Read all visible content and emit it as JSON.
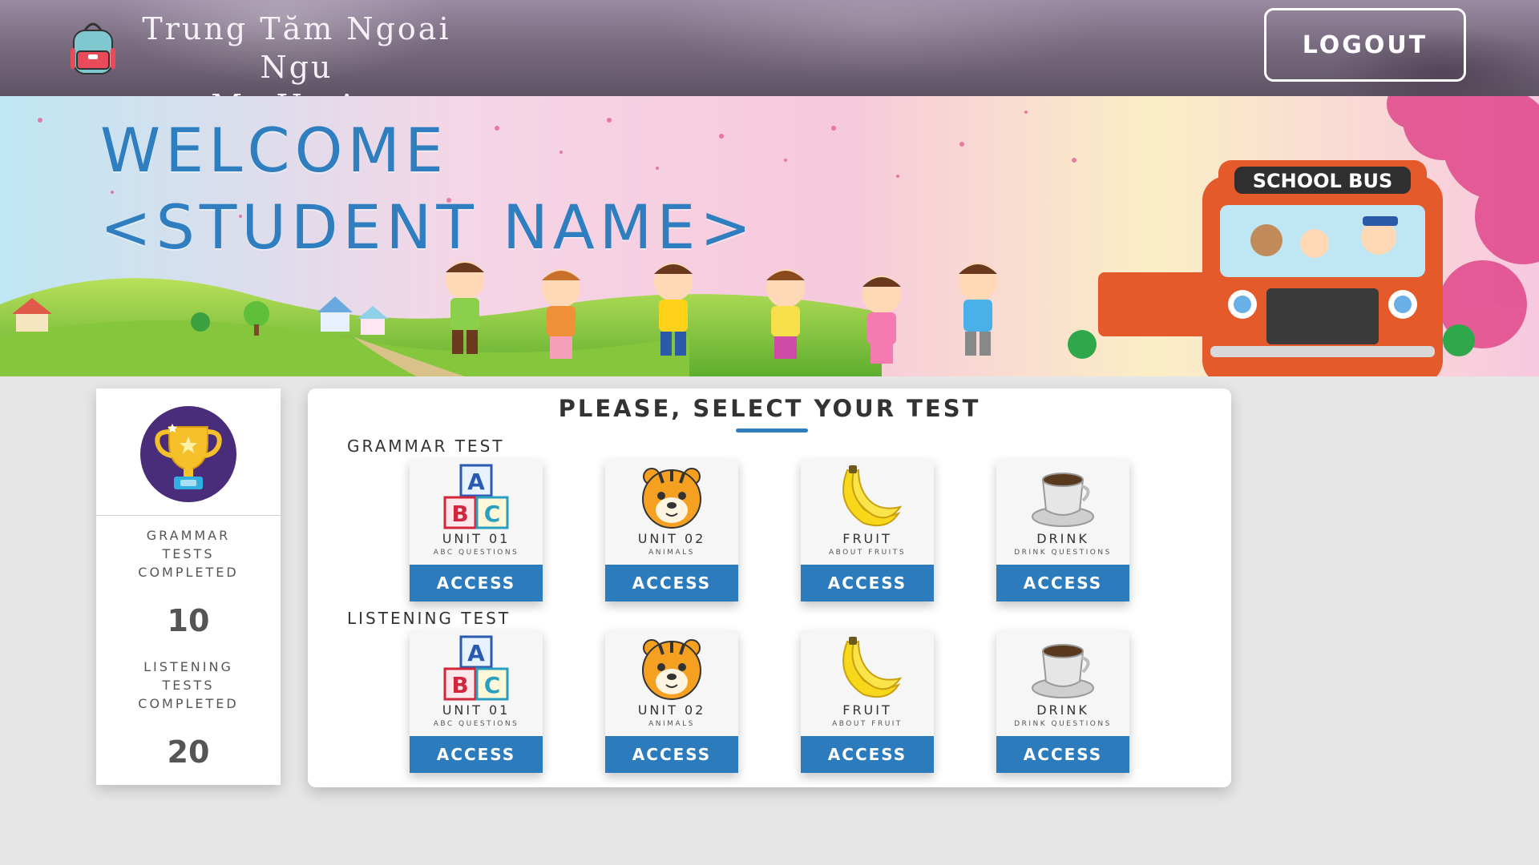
{
  "header": {
    "brand_line1": "Trung Tăm Ngoai Ngu",
    "brand_line2": "My Uc Au",
    "logo_icon": "backpack-icon",
    "logout_label": "LOGOUT"
  },
  "banner": {
    "welcome_line1": "WELCOME",
    "welcome_line2": "<STUDENT NAME>",
    "bus_sign": "SCHOOL BUS"
  },
  "stats": {
    "icon": "trophy-icon",
    "grammar_label": "GRAMMAR TESTS COMPLETED",
    "grammar_value": "10",
    "listening_label": "LISTENING TESTS COMPLETED",
    "listening_value": "20"
  },
  "main": {
    "title": "PLEASE, SELECT YOUR TEST",
    "grammar_section": {
      "title": "GRAMMAR TEST",
      "tests": [
        {
          "name": "UNIT 01",
          "subtitle": "ABC QUESTIONS",
          "icon": "abc-blocks-icon",
          "button": "ACCESS"
        },
        {
          "name": "UNIT 02",
          "subtitle": "ANIMALS",
          "icon": "tiger-icon",
          "button": "ACCESS"
        },
        {
          "name": "FRUIT",
          "subtitle": "ABOUT FRUITS",
          "icon": "banana-icon",
          "button": "ACCESS"
        },
        {
          "name": "DRINK",
          "subtitle": "DRINK QUESTIONS",
          "icon": "coffee-cup-icon",
          "button": "ACCESS"
        }
      ]
    },
    "listening_section": {
      "title": "LISTENING TEST",
      "tests": [
        {
          "name": "UNIT 01",
          "subtitle": "ABC QUESTIONS",
          "icon": "abc-blocks-icon",
          "button": "ACCESS"
        },
        {
          "name": "UNIT 02",
          "subtitle": "ANIMALS",
          "icon": "tiger-icon",
          "button": "ACCESS"
        },
        {
          "name": "FRUIT",
          "subtitle": "ABOUT FRUIT",
          "icon": "banana-icon",
          "button": "ACCESS"
        },
        {
          "name": "DRINK",
          "subtitle": "DRINK QUESTIONS",
          "icon": "coffee-cup-icon",
          "button": "ACCESS"
        }
      ]
    }
  },
  "colors": {
    "accent": "#2c7bbd",
    "trophy_bg": "#4a2d7a",
    "page_bg": "#e6e6e6",
    "welcome_text": "#2e7ec0"
  }
}
